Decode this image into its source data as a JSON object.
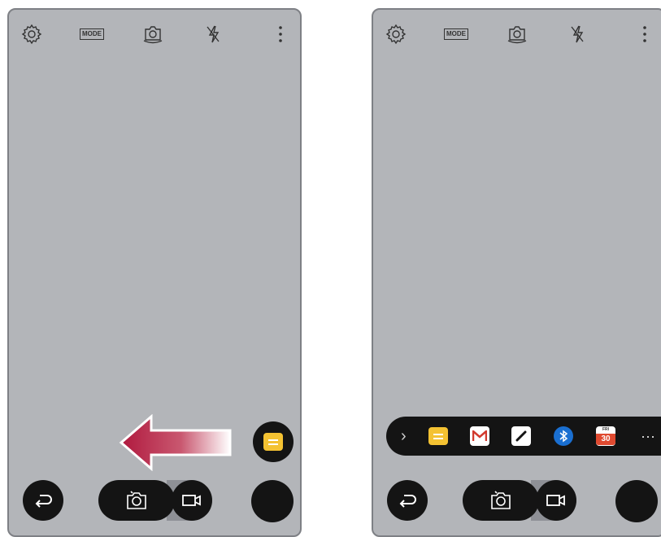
{
  "colors": {
    "screen": "#b3b5b9",
    "bar": "#141414",
    "memo": "#f4c232",
    "arrow": "#b0193e",
    "bluetooth": "#1a6fd1",
    "calendar": "#e04a30"
  },
  "left_screen": {
    "toolbar": {
      "mode_label": "MODE"
    },
    "quick_memo_handle": {
      "icon": "memo-icon"
    },
    "swipe_hint": {
      "direction": "left",
      "icon": "left-arrow-icon"
    },
    "bottom": {
      "back_icon": "back-icon",
      "photo_icon": "camera-icon",
      "video_icon": "video-icon"
    }
  },
  "right_screen": {
    "toolbar": {
      "mode_label": "MODE"
    },
    "quick_menu": {
      "items": [
        "expand-chevron-icon",
        "memo-icon",
        "gmail-icon",
        "pen-icon",
        "bluetooth-icon",
        "calendar-icon",
        "more-icon"
      ],
      "calendar_day": "FRI",
      "calendar_date": "30",
      "more_label": "···"
    },
    "bottom": {
      "back_icon": "back-icon",
      "photo_icon": "camera-icon",
      "video_icon": "video-icon"
    }
  }
}
